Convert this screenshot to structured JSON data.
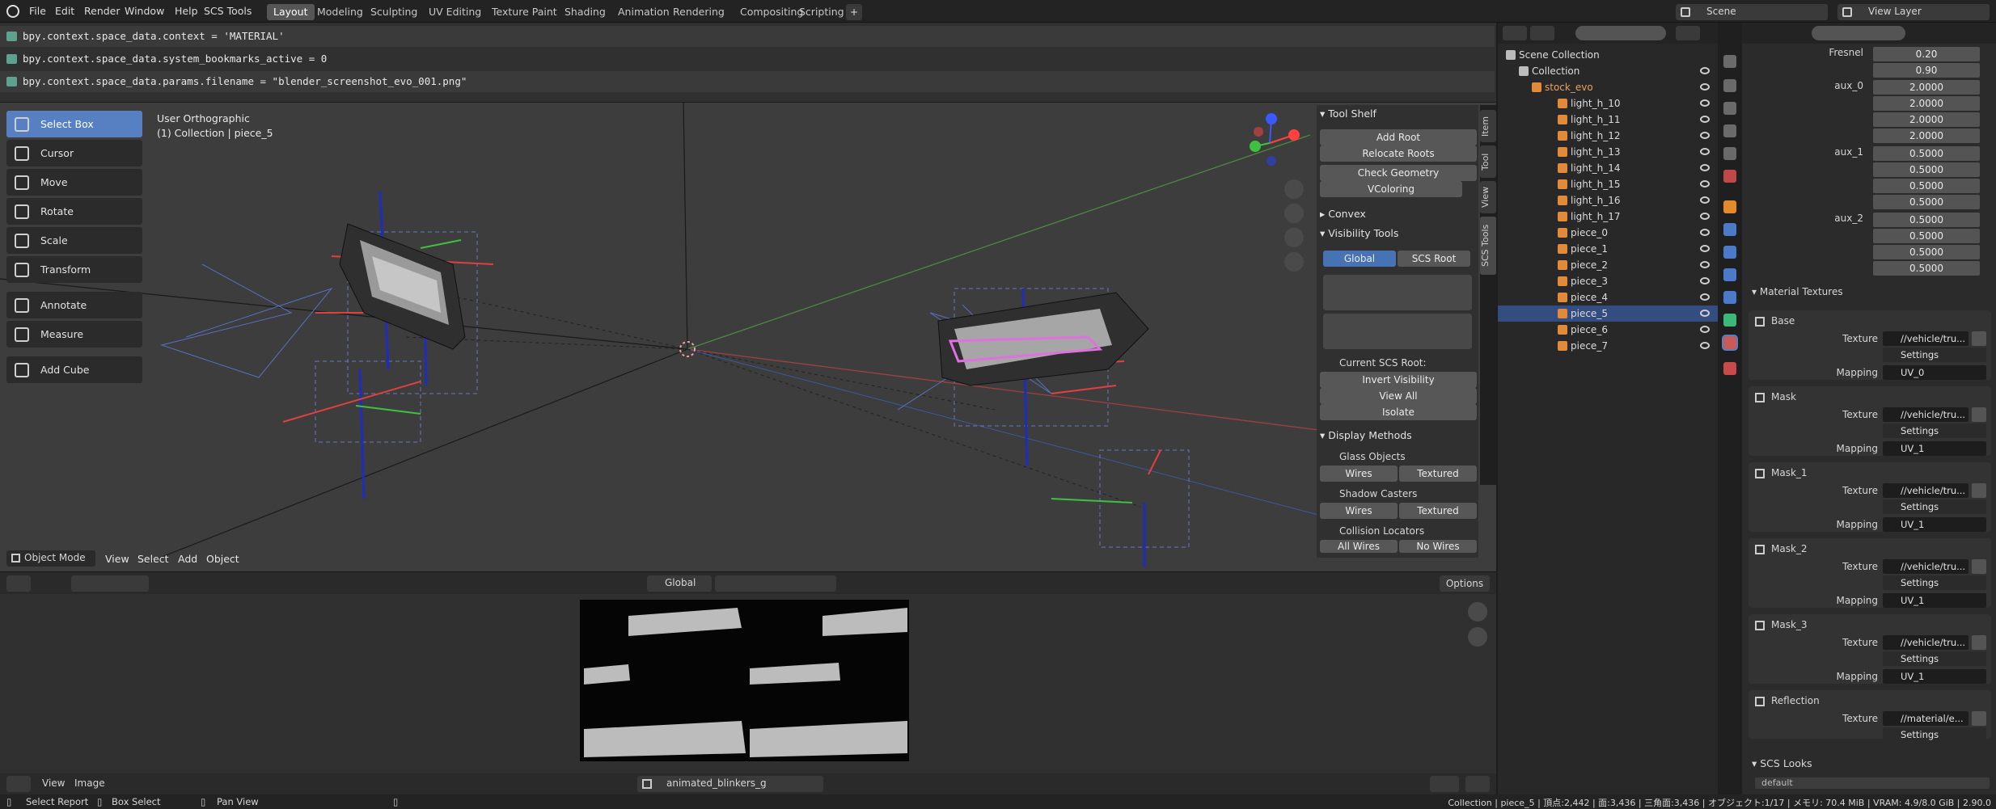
{
  "menu": {
    "file": "File",
    "edit": "Edit",
    "render": "Render",
    "window": "Window",
    "help": "Help",
    "scs_tools": "SCS Tools"
  },
  "workspaces": [
    "Layout",
    "Modeling",
    "Sculpting",
    "UV Editing",
    "Texture Paint",
    "Shading",
    "Animation",
    "Rendering",
    "Compositing",
    "Scripting"
  ],
  "header_right": {
    "scene": "Scene",
    "view_layer": "View Layer"
  },
  "console": {
    "lines": [
      "bpy.context.space_data.context = 'MATERIAL'",
      "bpy.context.space_data.system_bookmarks_active = 0",
      "bpy.context.space_data.params.filename = \"blender_screenshot_evo_001.png\""
    ]
  },
  "viewport": {
    "view_name": "User Orthographic",
    "collection_info": "(1) Collection | piece_5",
    "tools": [
      "Select Box",
      "Cursor",
      "Move",
      "Rotate",
      "Scale",
      "Transform",
      "Annotate",
      "Measure",
      "Add Cube"
    ],
    "mode": "Object Mode",
    "menus": [
      "View",
      "Select",
      "Add",
      "Object"
    ],
    "orientation": "Global",
    "options": "Options"
  },
  "npanel": {
    "tabs": [
      "Item",
      "Tool",
      "View",
      "SCS Tools"
    ],
    "tool_shelf": "Tool Shelf",
    "add_root": "Add Root",
    "relocate_roots": "Relocate Roots",
    "check_geometry": "Check Geometry",
    "vcoloring": "VColoring",
    "convex": "Convex",
    "visibility_tools": "Visibility Tools",
    "global": "Global",
    "scs_root": "SCS Root",
    "current_root": "Current SCS Root:",
    "invert_visibility": "Invert Visibility",
    "view_all": "View All",
    "isolate": "Isolate",
    "display_methods": "Display Methods",
    "glass_objects": "Glass Objects",
    "shadow_casters": "Shadow Casters",
    "collision_locators": "Collision Locators",
    "wires": "Wires",
    "textured": "Textured",
    "all_wires": "All Wires",
    "no_wires": "No Wires"
  },
  "image_editor": {
    "menus": [
      "View",
      "Image"
    ],
    "image_name": "animated_blinkers_g"
  },
  "outliner": {
    "scene_collection": "Scene Collection",
    "collection": "Collection",
    "root": "stock_evo",
    "lights": [
      "light_h_10",
      "light_h_11",
      "light_h_12",
      "light_h_13",
      "light_h_14",
      "light_h_15",
      "light_h_16",
      "light_h_17"
    ],
    "pieces": [
      "piece_0",
      "piece_1",
      "piece_2",
      "piece_3",
      "piece_4",
      "piece_5",
      "piece_6",
      "piece_7"
    ],
    "selected": "piece_5"
  },
  "properties": {
    "fresnel_label": "Fresnel",
    "fresnel": [
      "0.20",
      "0.90"
    ],
    "aux0_label": "aux_0",
    "aux0": [
      "2.0000",
      "2.0000",
      "2.0000",
      "2.0000"
    ],
    "aux1_label": "aux_1",
    "aux1": [
      "0.5000",
      "0.5000",
      "0.5000",
      "0.5000"
    ],
    "aux2_label": "aux_2",
    "aux2": [
      "0.5000",
      "0.5000",
      "0.5000",
      "0.5000"
    ],
    "material_textures": "Material Textures",
    "texture_label": "Texture",
    "mapping_label": "Mapping",
    "settings": "Settings",
    "textures": [
      {
        "name": "Base",
        "path": "//vehicle/tru...",
        "mapping": "UV_0"
      },
      {
        "name": "Mask",
        "path": "//vehicle/tru...",
        "mapping": "UV_1"
      },
      {
        "name": "Mask_1",
        "path": "//vehicle/tru...",
        "mapping": "UV_1"
      },
      {
        "name": "Mask_2",
        "path": "//vehicle/tru...",
        "mapping": "UV_1"
      },
      {
        "name": "Mask_3",
        "path": "//vehicle/tru...",
        "mapping": "UV_1"
      },
      {
        "name": "Reflection",
        "path": "//material/e...",
        "mapping": ""
      }
    ],
    "scs_looks": "SCS Looks",
    "look_default": "default"
  },
  "status": {
    "select": "Select Report",
    "box_select": "Box Select",
    "pan_view": "Pan View",
    "stats": "Collection | piece_5 | 頂点:2,442 | 面:3,436 | 三角面:3,436 | オブジェクト:1/17 | メモリ: 70.4 MiB | VRAM: 4.9/8.0 GiB | 2.90.0"
  },
  "colors": {
    "accent": "#4772b3",
    "selected_row": "#334d80",
    "active_tool": "#5680c2",
    "header": "#232323"
  }
}
